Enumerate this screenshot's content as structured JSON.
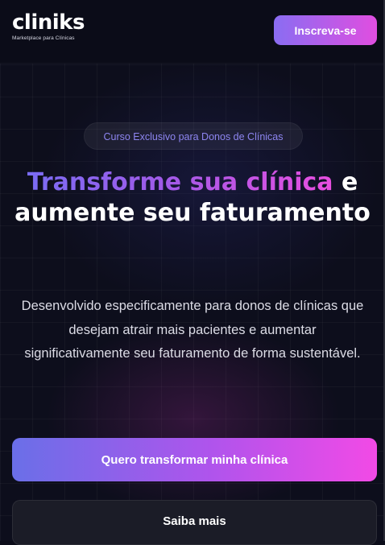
{
  "header": {
    "logo_text": "cliniks",
    "tagline": "Marketplace para Clínicas",
    "signup_button": "Inscreva-se"
  },
  "hero": {
    "badge": "Curso Exclusivo para Donos de Clínicas",
    "headline_highlight": "Transforme sua clínica",
    "headline_rest": " e aumente seu faturamento",
    "description": "Desenvolvido especificamente para donos de clínicas que desejam atrair mais pacientes e aumentar significativamente seu faturamento de forma sustentável.",
    "primary_cta": "Quero transformar minha clínica",
    "secondary_cta": "Saiba mais"
  },
  "colors": {
    "background": "#0d0e1c",
    "accent_start": "#7a6cf4",
    "accent_end": "#f24ae6",
    "badge_text": "#8d85f0"
  }
}
